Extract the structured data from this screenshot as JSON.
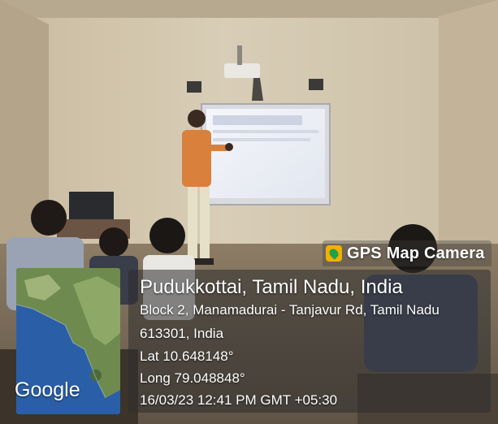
{
  "badge": {
    "label": "GPS Map Camera",
    "icon": "gps-map-camera-logo"
  },
  "location": {
    "title": "Pudukkottai, Tamil Nadu, India",
    "address_line1": "Block 2, Manamadurai - Tanjavur Rd, Tamil Nadu",
    "address_line2": "613301, India",
    "lat": "Lat 10.648148°",
    "long": "Long 79.048848°",
    "timestamp": "16/03/23 12:41 PM GMT +05:30"
  },
  "map": {
    "provider_label": "Google"
  }
}
